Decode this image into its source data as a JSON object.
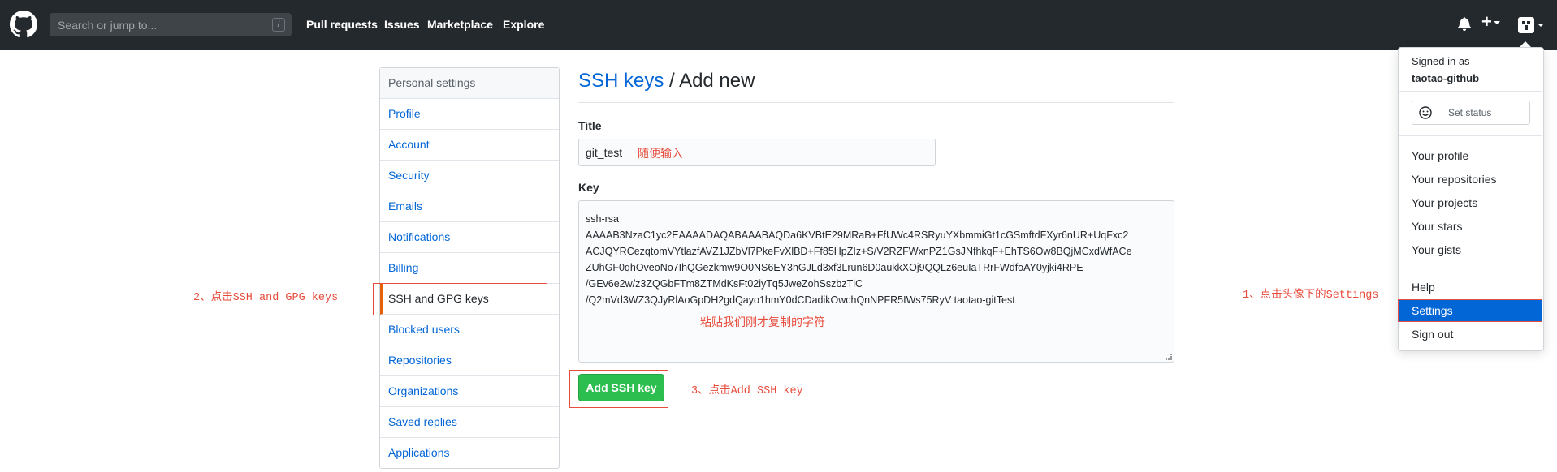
{
  "header": {
    "search_placeholder": "Search or jump to...",
    "search_shortcut": "/",
    "nav": [
      "Pull requests",
      "Issues",
      "Marketplace",
      "Explore"
    ],
    "plus": "+"
  },
  "sidebar": {
    "heading": "Personal settings",
    "items": [
      "Profile",
      "Account",
      "Security",
      "Emails",
      "Notifications",
      "Billing",
      "SSH and GPG keys",
      "Blocked users",
      "Repositories",
      "Organizations",
      "Saved replies",
      "Applications"
    ],
    "active_index": 6
  },
  "main": {
    "breadcrumb_link": "SSH keys",
    "breadcrumb_sep": " / ",
    "breadcrumb_current": "Add new",
    "title_label": "Title",
    "title_value": "git_test",
    "key_label": "Key",
    "key_lines": [
      "ssh-rsa",
      "AAAAB3NzaC1yc2EAAAADAQABAAABAQDa6KVBtE29MRaB+FfUWc4RSRyuYXbmmiGt1cGSmftdFXyr6nUR+UqFxc2",
      "ACJQYRCezqtomVYtlazfAVZ1JZbVl7PkeFvXlBD+Ff85HpZIz+S/V2RZFWxnPZ1GsJNfhkqF+EhTS6Ow8BQjMCxdWfACe",
      "ZUhGF0qhOveoNo7IhQGezkmw9O0NS6EY3hGJLd3xf3Lrun6D0aukkXOj9QQLz6euIaTRrFWdfoAY0yjki4RPE",
      "/GEv6e2w/z3ZQGbFTm8ZTMdKsFt02iyTq5JweZohSszbzTlC",
      "/Q2mVd3WZ3QJyRlAoGpDH2gdQayo1hmY0dCDadikOwchQnNPFR5IWs75RyV taotao-gitTest"
    ],
    "submit": "Add SSH key"
  },
  "annotations": {
    "title_hint": "随便输入",
    "key_hint": "粘贴我们刚才复制的字符",
    "step1": "1、点击头像下的Settings",
    "step2": "2、点击SSH and GPG keys",
    "step3": "3、点击Add SSH key"
  },
  "dropdown": {
    "signed_in": "Signed in as",
    "username": "taotao-github",
    "set_status": "Set status",
    "group1": [
      "Your profile",
      "Your repositories",
      "Your projects",
      "Your stars",
      "Your gists"
    ],
    "group2": [
      "Help",
      "Settings",
      "Sign out"
    ]
  },
  "colors": {
    "header_bg": "#24292e",
    "link": "#0366d6",
    "button_green": "#2cbe4e",
    "annotation_red": "#e74c3c",
    "active_border": "#e36209"
  }
}
